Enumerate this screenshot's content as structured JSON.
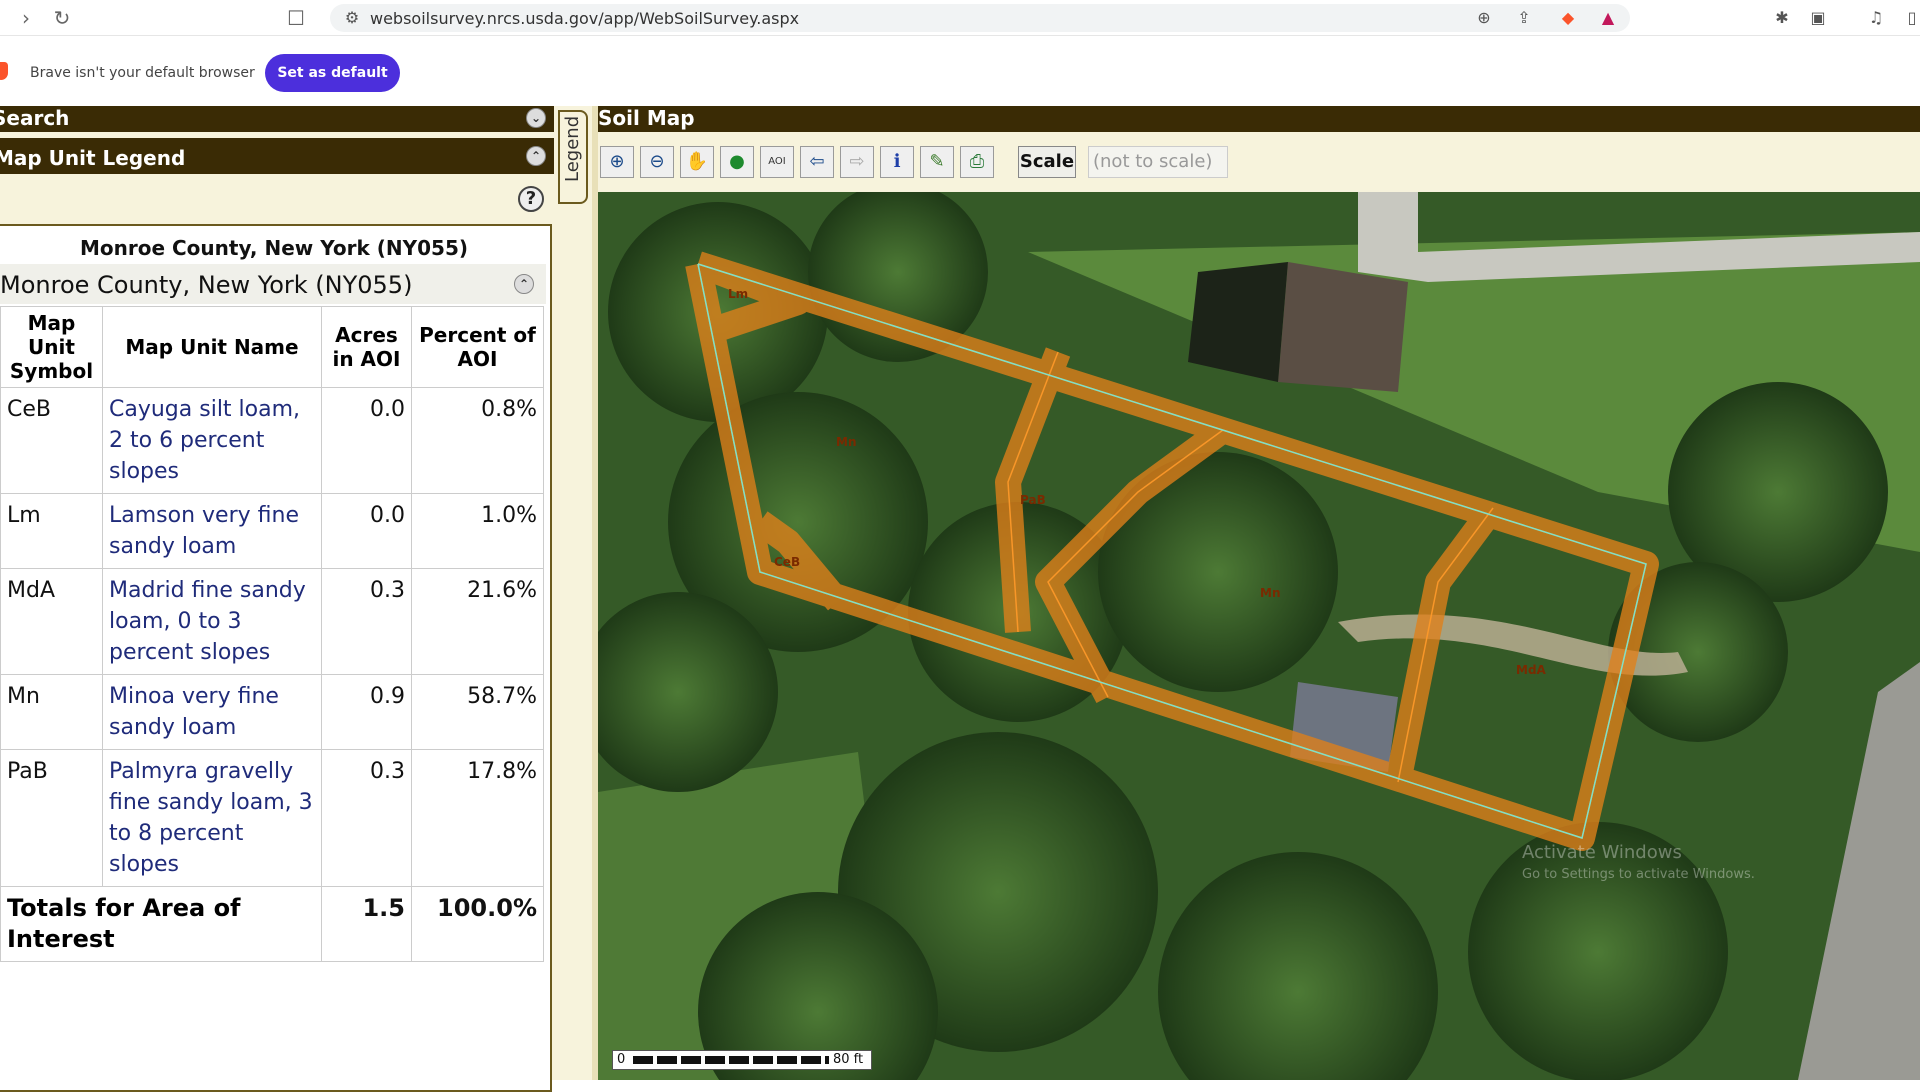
{
  "browser": {
    "url": "websoilsurvey.nrcs.usda.gov/app/WebSoilSurvey.aspx",
    "default_message": "Brave isn't your default browser",
    "set_default_label": "Set as default"
  },
  "left_panel": {
    "search_title": "Search",
    "legend_title": "Map Unit Legend",
    "help_glyph": "?",
    "county_heading": "Monroe County, New York (NY055)",
    "county_subheading": "Monroe County, New York (NY055)",
    "columns": {
      "symbol": "Map Unit Symbol",
      "name": "Map Unit Name",
      "acres": "Acres in AOI",
      "percent": "Percent of AOI"
    },
    "rows": [
      {
        "symbol": "CeB",
        "name": "Cayuga silt loam, 2 to 6 percent slopes",
        "acres": "0.0",
        "percent": "0.8%"
      },
      {
        "symbol": "Lm",
        "name": "Lamson very fine sandy loam",
        "acres": "0.0",
        "percent": "1.0%"
      },
      {
        "symbol": "MdA",
        "name": "Madrid fine sandy loam, 0 to 3 percent slopes",
        "acres": "0.3",
        "percent": "21.6%"
      },
      {
        "symbol": "Mn",
        "name": "Minoa very fine sandy loam",
        "acres": "0.9",
        "percent": "58.7%"
      },
      {
        "symbol": "PaB",
        "name": "Palmyra gravelly fine sandy loam, 3 to 8 percent slopes",
        "acres": "0.3",
        "percent": "17.8%"
      }
    ],
    "totals": {
      "label": "Totals for Area of Interest",
      "acres": "1.5",
      "percent": "100.0%"
    }
  },
  "legend_tab_label": "Legend",
  "map": {
    "title": "Soil Map",
    "scale_label": "Scale",
    "scale_value": "(not to scale)",
    "scalebar_start": "0",
    "scalebar_end": "80 ft",
    "tools": [
      "zoom-in-icon",
      "zoom-out-icon",
      "pan-icon",
      "globe-icon",
      "aoi-icon",
      "back-arrow-icon",
      "forward-arrow-icon",
      "info-icon",
      "measure-icon",
      "print-icon"
    ],
    "soil_labels": [
      "Lm",
      "Mn",
      "PaB",
      "CeB",
      "Mn",
      "MdA"
    ],
    "watermark_line1": "Activate Windows",
    "watermark_line2": "Go to Settings to activate Windows."
  },
  "colors": {
    "header_bg": "#3a2b05",
    "panel_bg": "#f7f3dc",
    "link_blue": "#1f2b7a",
    "aoi_orange": "#e0801a",
    "brave_purple": "#4c2fdc"
  }
}
